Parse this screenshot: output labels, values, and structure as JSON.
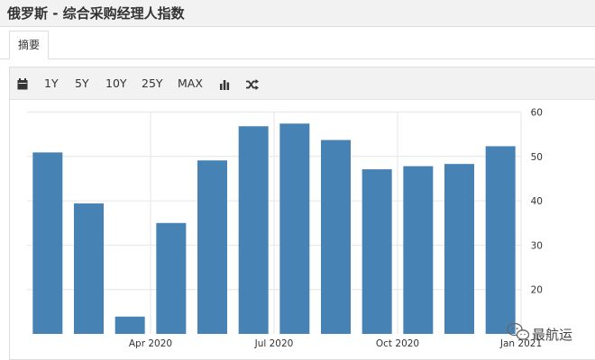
{
  "title": "俄罗斯 - 综合采购经理人指数",
  "tabs": [
    {
      "label": "摘要"
    }
  ],
  "toolbar": {
    "ranges": [
      "1Y",
      "5Y",
      "10Y",
      "25Y",
      "MAX"
    ],
    "icons": [
      "calendar-icon",
      "bar-chart-icon",
      "shuffle-icon"
    ]
  },
  "watermark": {
    "text": "最航运"
  },
  "colors": {
    "bar": "#4682b4",
    "grid": "#e6e6e6"
  },
  "chart_data": {
    "type": "bar",
    "categories": [
      "2020-01",
      "2020-02",
      "2020-03",
      "2020-04",
      "2020-05",
      "2020-06",
      "2020-07",
      "2020-08",
      "2020-09",
      "2020-10",
      "2020-11",
      "2020-12"
    ],
    "values": [
      50.9,
      39.4,
      13.9,
      35.0,
      49.1,
      56.8,
      57.4,
      53.7,
      47.1,
      47.8,
      48.3,
      52.3
    ],
    "ylim": [
      10,
      60
    ],
    "yticks": [
      20,
      30,
      40,
      50,
      60
    ],
    "xtick_labels": [
      {
        "label": "Apr 2020",
        "category": "2020-03"
      },
      {
        "label": "Jul 2020",
        "category": "2020-06"
      },
      {
        "label": "Oct 2020",
        "category": "2020-09"
      },
      {
        "label": "Jan 2021",
        "category": "2020-12"
      }
    ],
    "y_axis_side": "right",
    "grid": true,
    "legend": "none"
  }
}
